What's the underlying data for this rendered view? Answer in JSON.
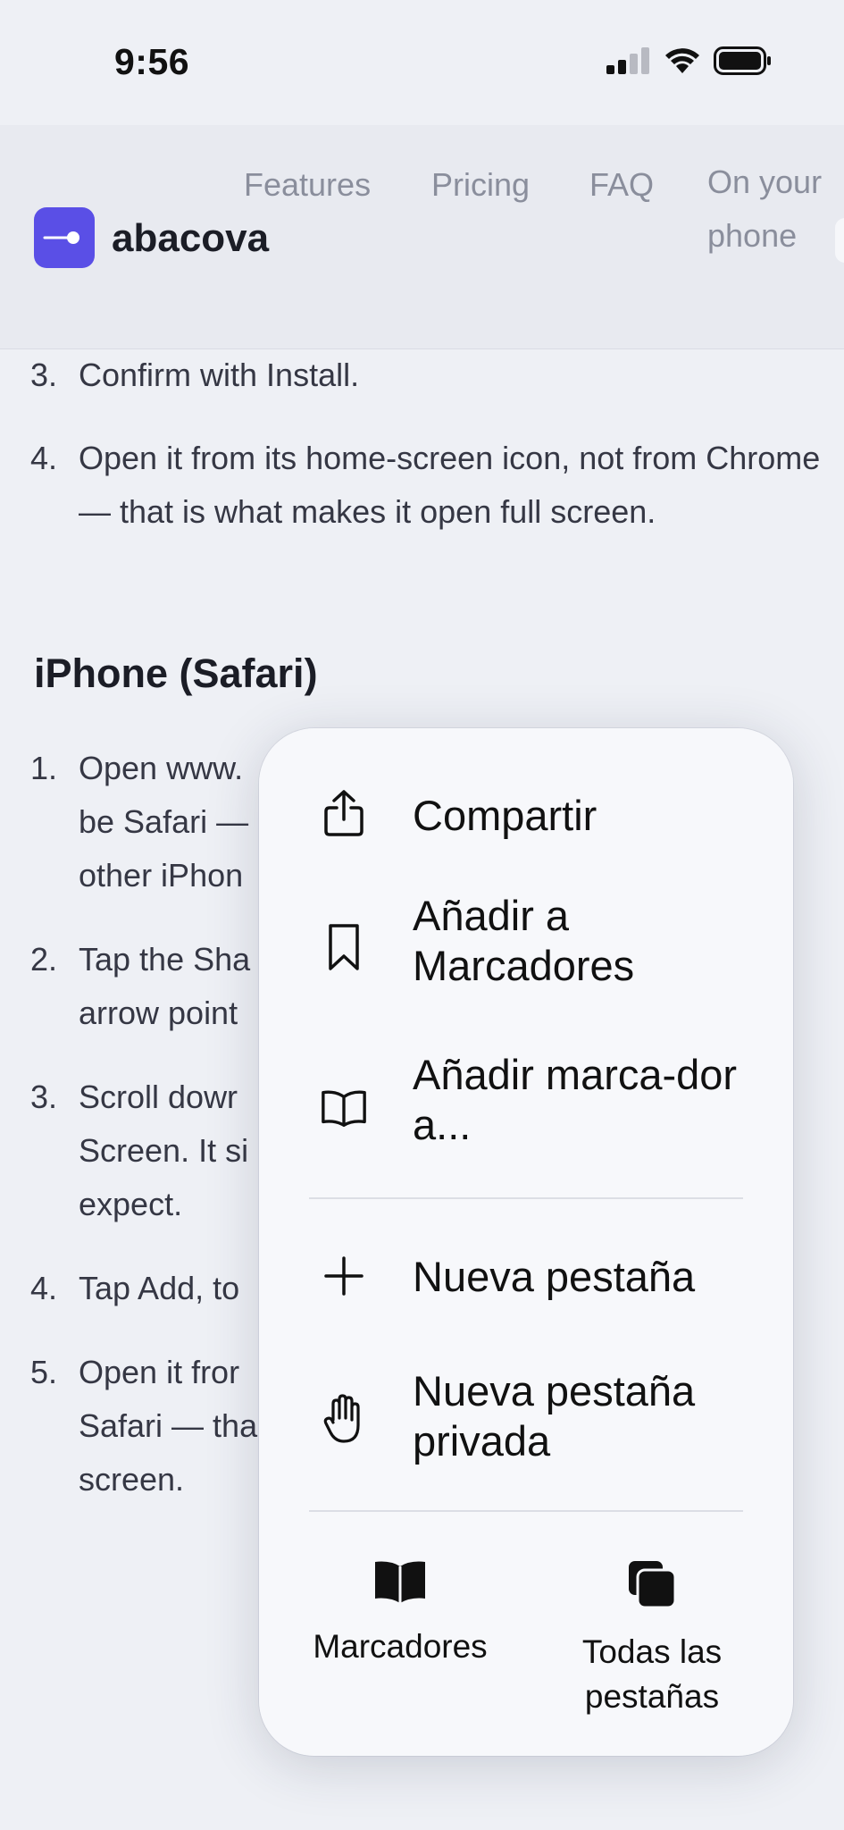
{
  "status_bar": {
    "time": "9:56"
  },
  "header": {
    "brand": "abacova",
    "nav": [
      "Features",
      "Pricing",
      "FAQ",
      "On your phone"
    ]
  },
  "article": {
    "android_steps": [
      {
        "num": "3.",
        "text": "Confirm with Install."
      },
      {
        "num": "4.",
        "text": "Open it from its home-screen icon, not from Chrome — that is what makes it open full screen."
      }
    ],
    "iphone_heading": "iPhone (Safari)",
    "iphone_steps": [
      {
        "num": "1.",
        "text": "Open www."
      },
      {
        "num": "",
        "text": "be Safari —"
      },
      {
        "num": "",
        "text": "other iPhon"
      },
      {
        "num": "2.",
        "text": "Tap the Sha"
      },
      {
        "num": "",
        "text": "arrow point"
      },
      {
        "num": "3.",
        "text": "Scroll dowr"
      },
      {
        "num": "",
        "text": "Screen. It si"
      },
      {
        "num": "",
        "text": "expect."
      },
      {
        "num": "4.",
        "text": "Tap Add, to"
      },
      {
        "num": "5.",
        "text": "Open it fror"
      },
      {
        "num": "",
        "text": "Safari — tha"
      },
      {
        "num": "",
        "text": "screen."
      }
    ]
  },
  "menu": {
    "items": [
      {
        "label": "Compartir",
        "icon": "share-icon"
      },
      {
        "label": "Añadir a Marcadores",
        "icon": "bookmark-icon"
      },
      {
        "label": "Añadir marca-dor a...",
        "icon": "book-icon"
      },
      {
        "label": "Nueva pestaña",
        "icon": "plus-icon"
      },
      {
        "label": "Nueva pestaña privada",
        "icon": "hand-icon"
      }
    ],
    "bottom": [
      {
        "label": "Marcadores",
        "icon": "bookmarks-book-icon"
      },
      {
        "label": "Todas las pestañas",
        "icon": "tabs-icon"
      }
    ]
  },
  "colors": {
    "accent": "#5a4fe6",
    "text": "#353744",
    "nav": "#8a8e9c"
  }
}
